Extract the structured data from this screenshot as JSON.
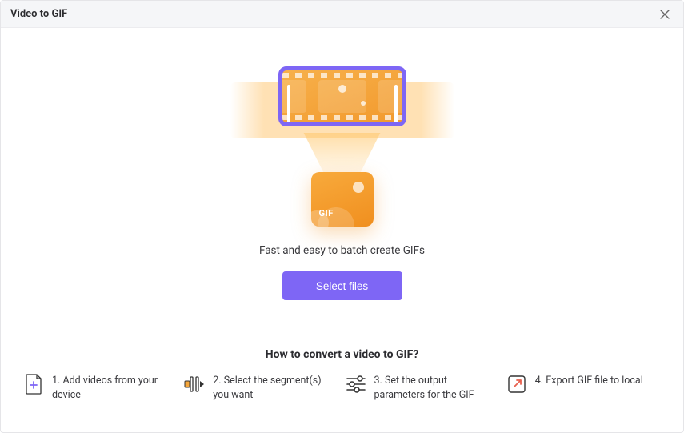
{
  "window": {
    "title": "Video to GIF"
  },
  "hero": {
    "gif_label": "GIF",
    "tagline": "Fast and easy to batch create GIFs",
    "select_button": "Select files"
  },
  "howto": {
    "title": "How to convert a video to GIF?",
    "steps": [
      {
        "num": "1.",
        "text": "Add videos from your device"
      },
      {
        "num": "2.",
        "text": "Select the segment(s) you want"
      },
      {
        "num": "3.",
        "text": "Set the output parameters for the GIF"
      },
      {
        "num": "4.",
        "text": "Export GIF file to local"
      }
    ]
  }
}
